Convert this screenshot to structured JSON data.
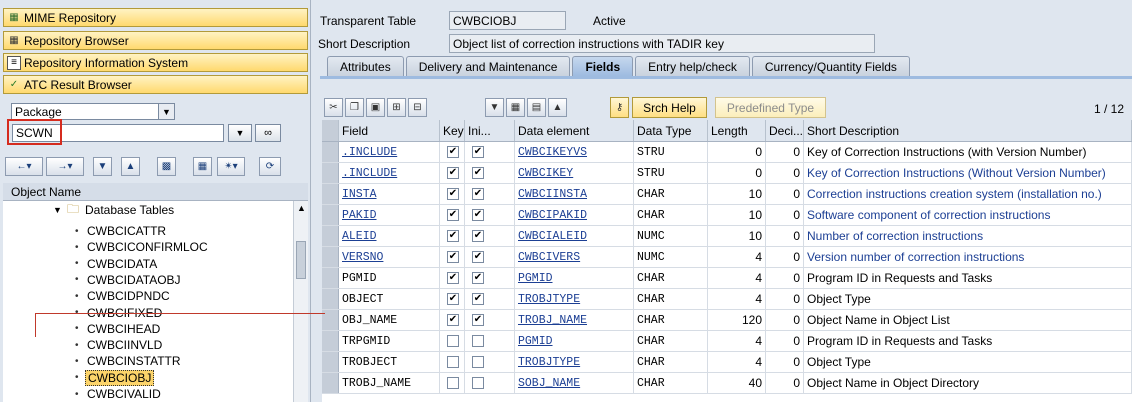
{
  "nav": {
    "mime": "MIME Repository",
    "repo_browser": "Repository Browser",
    "repo_info": "Repository Information System",
    "atc": "ATC Result Browser"
  },
  "object_list": {
    "type_selected": "Package",
    "object_value": "SCWN"
  },
  "tree": {
    "header": "Object Name",
    "folder": "Database Tables",
    "items": [
      "CWBCICATTR",
      "CWBCICONFIRMLOC",
      "CWBCIDATA",
      "CWBCIDATAOBJ",
      "CWBCIDPNDC",
      "CWBCIFIXED",
      "CWBCIHEAD",
      "CWBCIINVLD",
      "CWBCINSTATTR",
      "CWBCIOBJ",
      "CWBCIVALID"
    ],
    "selected": "CWBCIOBJ"
  },
  "header": {
    "table_type_label": "Transparent Table",
    "table_name": "CWBCIOBJ",
    "status": "Active",
    "short_desc_label": "Short Description",
    "short_desc": "Object list of correction instructions with TADIR key"
  },
  "tabs": [
    "Attributes",
    "Delivery and Maintenance",
    "Fields",
    "Entry help/check",
    "Currency/Quantity Fields"
  ],
  "active_tab": "Fields",
  "toolbar": {
    "srch_help": "Srch Help",
    "predefined_type": "Predefined Type",
    "pager": "1  /  12"
  },
  "columns": [
    "Field",
    "Key",
    "Ini...",
    "Data element",
    "Data Type",
    "Length",
    "Deci...",
    "Short Description"
  ],
  "fields": [
    {
      "field": ".INCLUDE",
      "key": true,
      "ini": true,
      "elem": "CWBCIKEYVS",
      "type": "STRU",
      "len": "0",
      "dec": "0",
      "desc": "Key of Correction Instructions (with Version Number)",
      "blue": false
    },
    {
      "field": ".INCLUDE",
      "key": true,
      "ini": true,
      "elem": "CWBCIKEY",
      "type": "STRU",
      "len": "0",
      "dec": "0",
      "desc": "Key of Correction Instructions (Without Version Number)",
      "blue": true
    },
    {
      "field": "INSTA",
      "key": true,
      "ini": true,
      "elem": "CWBCIINSTA",
      "type": "CHAR",
      "len": "10",
      "dec": "0",
      "desc": "Correction instructions creation system (installation no.)",
      "blue": true
    },
    {
      "field": "PAKID",
      "key": true,
      "ini": true,
      "elem": "CWBCIPAKID",
      "type": "CHAR",
      "len": "10",
      "dec": "0",
      "desc": "Software component of correction instructions",
      "blue": true
    },
    {
      "field": "ALEID",
      "key": true,
      "ini": true,
      "elem": "CWBCIALEID",
      "type": "NUMC",
      "len": "10",
      "dec": "0",
      "desc": "Number of correction instructions",
      "blue": true
    },
    {
      "field": "VERSNO",
      "key": true,
      "ini": true,
      "elem": "CWBCIVERS",
      "type": "NUMC",
      "len": "4",
      "dec": "0",
      "desc": "Version number of correction instructions",
      "blue": true
    },
    {
      "field": "PGMID",
      "key": true,
      "ini": true,
      "elem": "PGMID",
      "type": "CHAR",
      "len": "4",
      "dec": "0",
      "desc": "Program ID in Requests and Tasks",
      "blue": false
    },
    {
      "field": "OBJECT",
      "key": true,
      "ini": true,
      "elem": "TROBJTYPE",
      "type": "CHAR",
      "len": "4",
      "dec": "0",
      "desc": "Object Type",
      "blue": false
    },
    {
      "field": "OBJ_NAME",
      "key": true,
      "ini": true,
      "elem": "TROBJ_NAME",
      "type": "CHAR",
      "len": "120",
      "dec": "0",
      "desc": "Object Name in Object List",
      "blue": false
    },
    {
      "field": "TRPGMID",
      "key": false,
      "ini": false,
      "elem": "PGMID",
      "type": "CHAR",
      "len": "4",
      "dec": "0",
      "desc": "Program ID in Requests and Tasks",
      "blue": false
    },
    {
      "field": "TROBJECT",
      "key": false,
      "ini": false,
      "elem": "TROBJTYPE",
      "type": "CHAR",
      "len": "4",
      "dec": "0",
      "desc": "Object Type",
      "blue": false
    },
    {
      "field": "TROBJ_NAME",
      "key": false,
      "ini": false,
      "elem": "SOBJ_NAME",
      "type": "CHAR",
      "len": "40",
      "dec": "0",
      "desc": "Object Name in Object Directory",
      "blue": false
    }
  ]
}
